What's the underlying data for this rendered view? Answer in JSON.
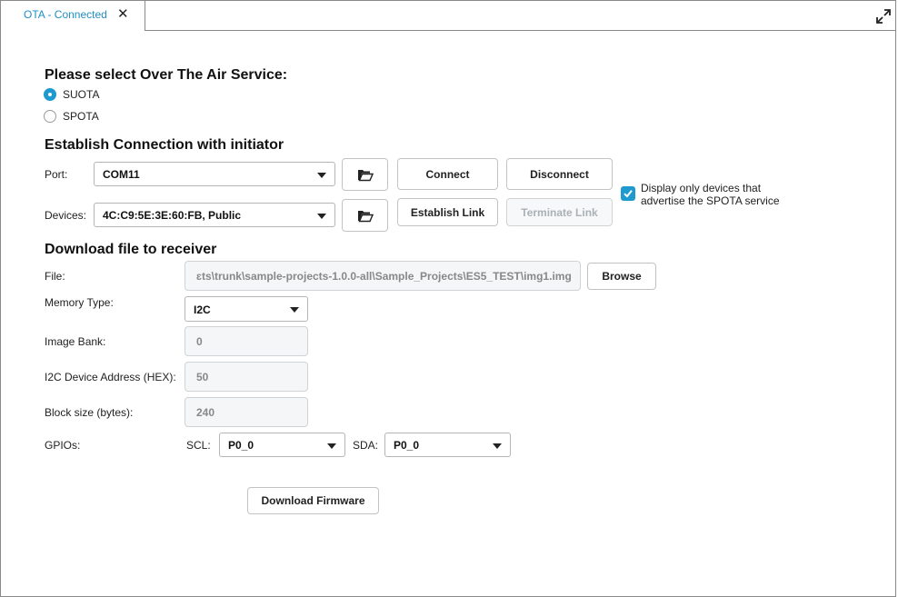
{
  "tab": {
    "title": "OTA - Connected",
    "close_glyph": "✕"
  },
  "ota_service": {
    "heading": "Please select Over The Air Service:",
    "options": [
      {
        "label": "SUOTA",
        "selected": true
      },
      {
        "label": "SPOTA",
        "selected": false
      }
    ]
  },
  "connection": {
    "heading": "Establish Connection with initiator",
    "port_label": "Port:",
    "port_value": "COM11",
    "devices_label": "Devices:",
    "devices_value": "4C:C9:5E:3E:60:FB, Public",
    "connect_label": "Connect",
    "disconnect_label": "Disconnect",
    "establish_link_label": "Establish Link",
    "terminate_link_label": "Terminate Link",
    "spota_filter_label": "Display only devices that advertise the SPOTA service",
    "spota_filter_checked": true
  },
  "download": {
    "heading": "Download file to receiver",
    "file_label": "File:",
    "file_value": "ɛts\\trunk\\sample-projects-1.0.0-all\\Sample_Projects\\ES5_TEST\\img1.img",
    "browse_label": "Browse",
    "memory_type_label": "Memory Type:",
    "memory_type_value": "I2C",
    "image_bank_label": "Image Bank:",
    "image_bank_value": "0",
    "i2c_address_label": "I2C Device Address (HEX):",
    "i2c_address_value": "50",
    "block_size_label": "Block size (bytes):",
    "block_size_value": "240",
    "gpios_label": "GPIOs:",
    "scl_label": "SCL:",
    "scl_value": "P0_0",
    "sda_label": "SDA:",
    "sda_value": "P0_0",
    "download_button_label": "Download Firmware"
  },
  "colors": {
    "accent": "#1f9ad0",
    "tab_text": "#1f8fc4",
    "disabled_text": "#a9b0b6"
  },
  "icons": [
    "close-icon",
    "maximize-icon",
    "folder-open-icon",
    "chevron-down-icon",
    "checkmark-icon"
  ]
}
